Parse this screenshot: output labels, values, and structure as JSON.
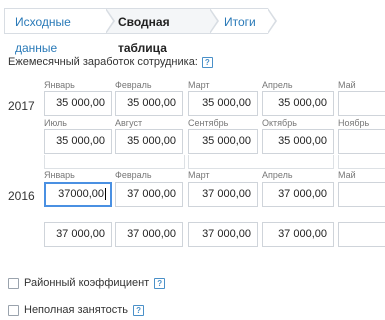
{
  "tabs": [
    {
      "label": "Исходные данные"
    },
    {
      "label": "Сводная таблица"
    },
    {
      "label": "Итоги"
    }
  ],
  "section": {
    "label": "Ежемесячный заработок сотрудника:",
    "help": "?"
  },
  "years": [
    {
      "year": "2017",
      "row1": [
        {
          "month": "Январь",
          "value": "35 000,00"
        },
        {
          "month": "Февраль",
          "value": "35 000,00"
        },
        {
          "month": "Март",
          "value": "35 000,00"
        },
        {
          "month": "Апрель",
          "value": "35 000,00"
        },
        {
          "month": "Май",
          "value": ""
        }
      ],
      "row2": [
        {
          "month": "Июль",
          "value": "35 000,00"
        },
        {
          "month": "Август",
          "value": "35 000,00"
        },
        {
          "month": "Сентябрь",
          "value": "35 000,00"
        },
        {
          "month": "Октябрь",
          "value": "35 000,00"
        },
        {
          "month": "Ноябрь",
          "value": ""
        }
      ]
    },
    {
      "year": "2016",
      "row1": [
        {
          "month": "Январь",
          "value": "37000,00"
        },
        {
          "month": "Февраль",
          "value": "37 000,00"
        },
        {
          "month": "Март",
          "value": "37 000,00"
        },
        {
          "month": "Апрель",
          "value": "37 000,00"
        },
        {
          "month": "Май",
          "value": ""
        }
      ],
      "row2": [
        {
          "month": "",
          "value": "37 000,00"
        },
        {
          "month": "",
          "value": "37 000,00"
        },
        {
          "month": "",
          "value": "37 000,00"
        },
        {
          "month": "",
          "value": "37 000,00"
        },
        {
          "month": "",
          "value": ""
        }
      ]
    }
  ],
  "options": [
    {
      "label": "Районный коэффициент",
      "help": "?"
    },
    {
      "label": "Неполная занятость",
      "help": "?"
    }
  ],
  "colors": {
    "link": "#2a7ab8",
    "focus": "#4a90e2",
    "border": "#cfd4da"
  }
}
